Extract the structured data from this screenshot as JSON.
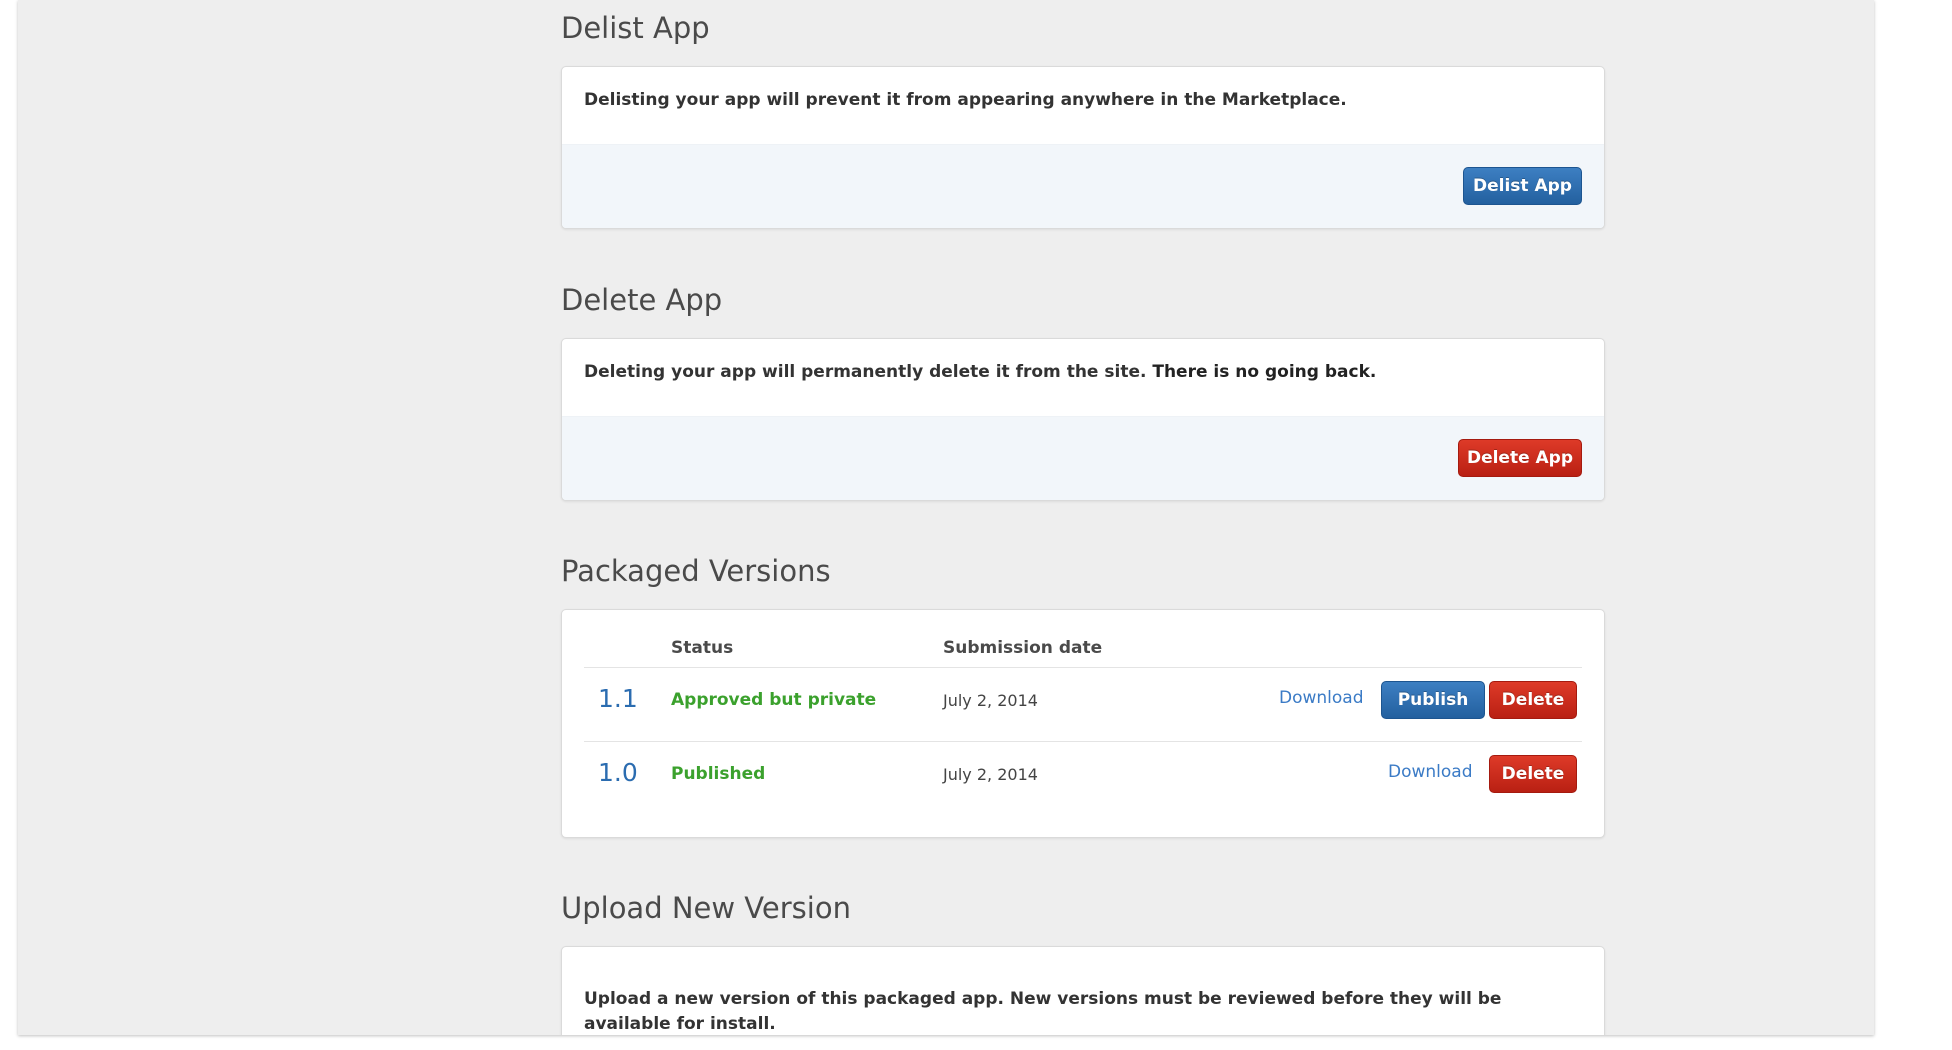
{
  "delist": {
    "title": "Delist App",
    "description": "Delisting your app will prevent it from appearing anywhere in the Marketplace.",
    "button_label": "Delist App"
  },
  "delete": {
    "title": "Delete App",
    "description": "Deleting your app will permanently delete it from the site.",
    "description_strong": "There is no going back.",
    "button_label": "Delete App"
  },
  "packaged": {
    "title": "Packaged Versions",
    "columns": [
      "Status",
      "Submission date"
    ],
    "versions": [
      {
        "version": "1.1",
        "status": "Approved but private",
        "date": "July 2, 2014",
        "download_label": "Download",
        "publish_label": "Publish",
        "delete_label": "Delete"
      },
      {
        "version": "1.0",
        "status": "Published",
        "date": "July 2, 2014",
        "download_label": "Download",
        "delete_label": "Delete"
      }
    ]
  },
  "upload": {
    "title": "Upload New Version",
    "description": "Upload a new version of this packaged app. New versions must be reviewed before they will be available for install."
  },
  "colors": {
    "primary_blue": "#2b6cb0",
    "danger_red": "#c6291a",
    "status_green": "#3ba12d"
  }
}
